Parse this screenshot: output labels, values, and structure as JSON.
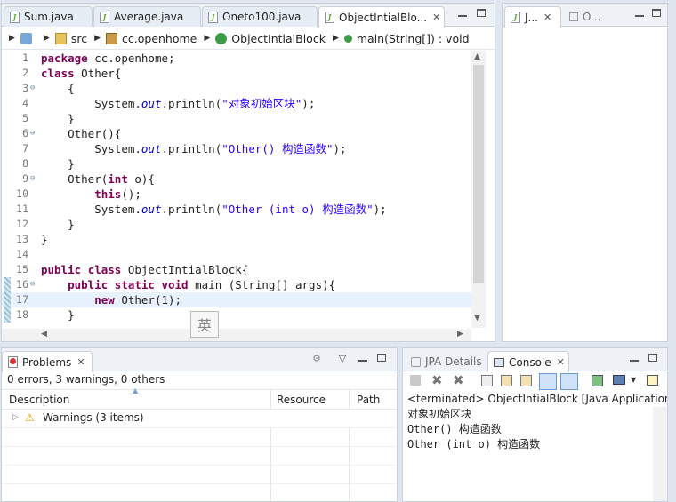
{
  "editor": {
    "tabs": [
      {
        "label": "Sum.java"
      },
      {
        "label": "Average.java"
      },
      {
        "label": "Oneto100.java"
      },
      {
        "label": "ObjectIntialBlo..."
      }
    ],
    "breadcrumb": {
      "src": "src",
      "package": "cc.openhome",
      "class": "ObjectIntialBlock",
      "method": "main(String[]) : void"
    },
    "lines": [
      {
        "n": "1"
      },
      {
        "n": "2"
      },
      {
        "n": "3"
      },
      {
        "n": "4"
      },
      {
        "n": "5"
      },
      {
        "n": "6"
      },
      {
        "n": "7"
      },
      {
        "n": "8"
      },
      {
        "n": "9"
      },
      {
        "n": "10"
      },
      {
        "n": "11"
      },
      {
        "n": "12"
      },
      {
        "n": "13"
      },
      {
        "n": "14"
      },
      {
        "n": "15"
      },
      {
        "n": "16"
      },
      {
        "n": "17"
      },
      {
        "n": "18"
      }
    ],
    "code": {
      "l1_kw": "package",
      "l1_rest": " cc.openhome;",
      "l2_kw": "class",
      "l2_rest": " Other{",
      "l3": "{",
      "l4_a": "System.",
      "l4_out": "out",
      "l4_b": ".println(",
      "l4_q1": "\"",
      "l4_cn": "对象初始区块",
      "l4_q2": "\"",
      "l4_c": ");",
      "l5": "}",
      "l6": "Other(){",
      "l7_a": "System.",
      "l7_out": "out",
      "l7_b": ".println(",
      "l7_s": "\"Other() ",
      "l7_cn": "构造函数",
      "l7_q": "\"",
      "l7_c": ");",
      "l8": "}",
      "l9_a": "Other(",
      "l9_kw": "int",
      "l9_b": " o){",
      "l10_kw": "this",
      "l10_rest": "();",
      "l11_a": "System.",
      "l11_out": "out",
      "l11_b": ".println(",
      "l11_s": "\"Other (int o) ",
      "l11_cn": "构造函数",
      "l11_q": "\"",
      "l11_c": ");",
      "l12": "}",
      "l13": "}",
      "l14": "",
      "l15_kw1": "public",
      "l15_kw2": "class",
      "l15_rest": " ObjectIntialBlock{",
      "l16_kw1": "public",
      "l16_kw2": "static",
      "l16_kw3": "void",
      "l16_rest": " main (String[] args){",
      "l17_kw": "new",
      "l17_rest": " Other(1);",
      "l18": "}"
    },
    "ime_label": "英"
  },
  "outline": {
    "tabs": [
      {
        "label": "J..."
      },
      {
        "label": "O..."
      }
    ]
  },
  "problems": {
    "title": "Problems",
    "summary": "0 errors, 3 warnings, 0 others",
    "columns": [
      "Description",
      "Resource",
      "Path"
    ],
    "rows": [
      {
        "description": "Warnings (3 items)"
      }
    ]
  },
  "console": {
    "tab_jpa": "JPA Details",
    "tab_console": "Console",
    "terminated": "<terminated> ObjectIntialBlock [Java Application]",
    "output": [
      "对象初始区块",
      "Other() 构造函数",
      "Other (int o) 构造函数"
    ]
  }
}
